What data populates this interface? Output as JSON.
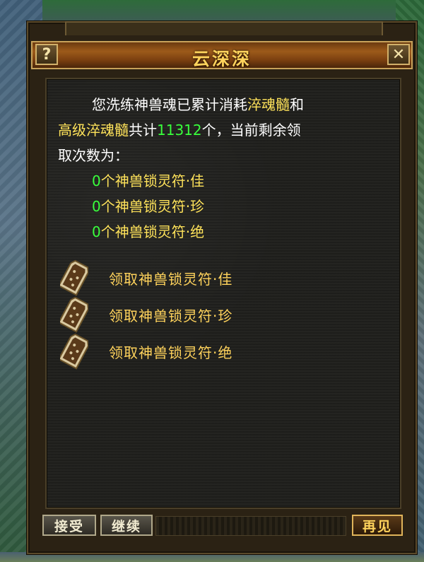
{
  "dialog": {
    "title": "云深深",
    "help_glyph": "?",
    "close_glyph": "✕",
    "message": {
      "line1_a": "您洗练神兽魂已累计消耗",
      "line1_item": "淬魂髓",
      "line1_b": "和",
      "line2_item": "高级淬魂髓",
      "line2_a": "共计",
      "line2_total": "11312",
      "line2_b": "个，当前剩余领",
      "line3": "取次数为："
    },
    "counts": [
      {
        "num": "0",
        "label": "个神兽锁灵符·佳"
      },
      {
        "num": "0",
        "label": "个神兽锁灵符·珍"
      },
      {
        "num": "0",
        "label": "个神兽锁灵符·绝"
      }
    ],
    "claim_options": [
      {
        "label": "领取神兽锁灵符·佳",
        "icon": "talisman-icon"
      },
      {
        "label": "领取神兽锁灵符·珍",
        "icon": "talisman-icon"
      },
      {
        "label": "领取神兽锁灵符·绝",
        "icon": "talisman-icon"
      }
    ],
    "buttons": {
      "accept": "接受",
      "continue": "继续",
      "goodbye": "再见"
    },
    "colors": {
      "highlight_yellow": "#ffe35a",
      "highlight_green": "#39ff3c",
      "title_gold": "#ffd35c"
    }
  }
}
